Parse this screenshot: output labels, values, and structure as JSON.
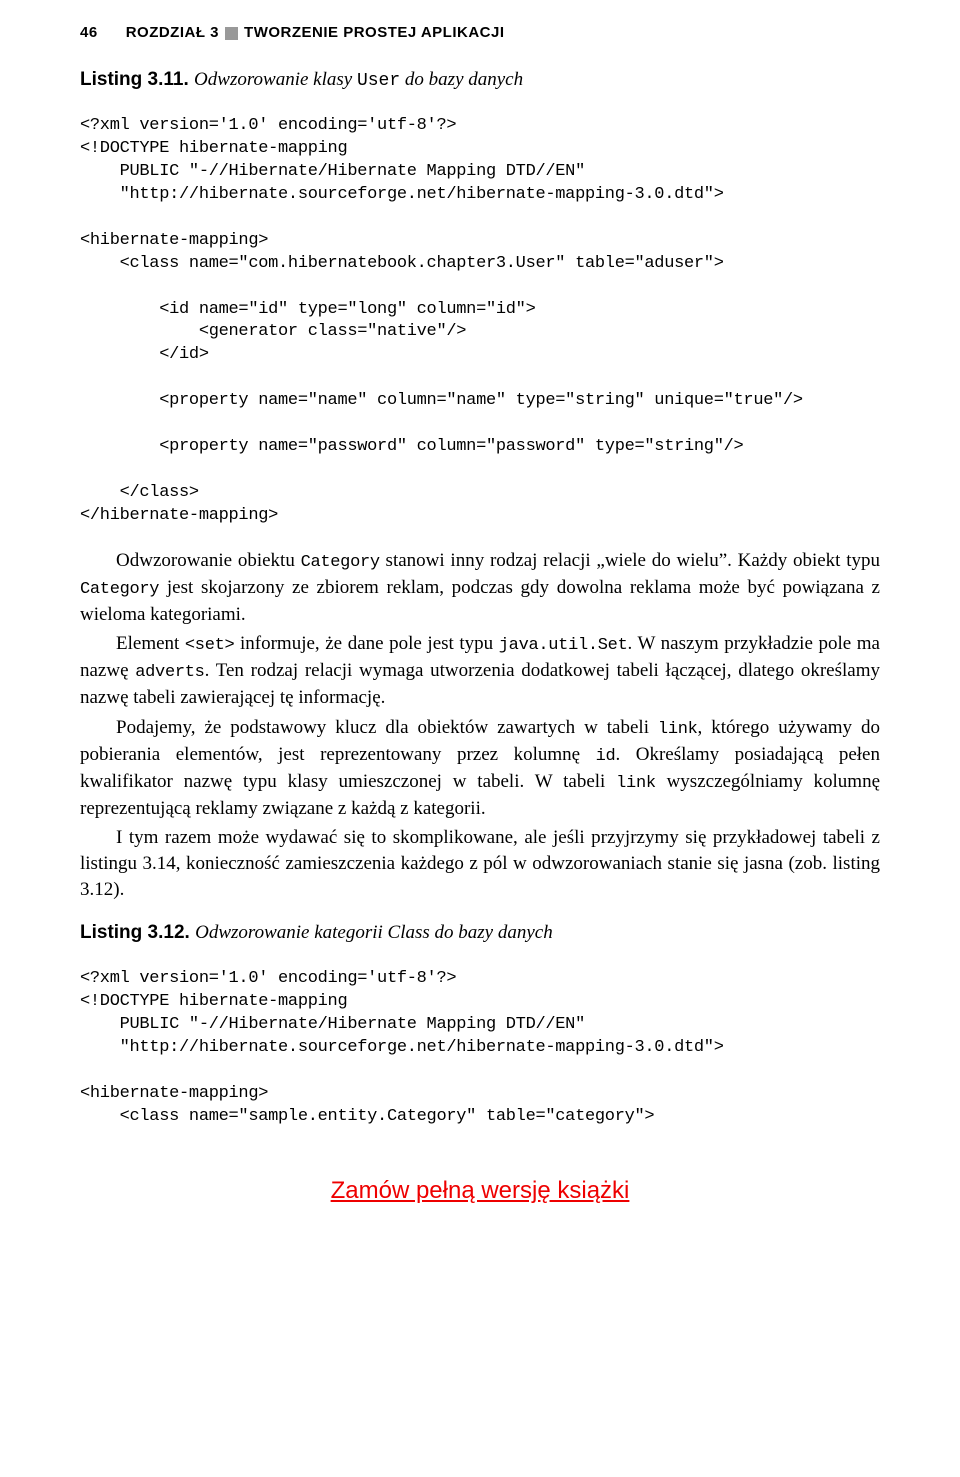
{
  "header": {
    "page_number": "46",
    "chapter_prefix": "ROZDZIAŁ 3",
    "chapter_title": "TWORZENIE PROSTEJ APLIKACJI"
  },
  "listing311": {
    "label": "Listing 3.11.",
    "caption_before": "Odwzorowanie klasy ",
    "caption_mono": "User",
    "caption_after": " do bazy danych",
    "code": "<?xml version='1.0' encoding='utf-8'?>\n<!DOCTYPE hibernate-mapping\n    PUBLIC \"-//Hibernate/Hibernate Mapping DTD//EN\"\n    \"http://hibernate.sourceforge.net/hibernate-mapping-3.0.dtd\">\n\n<hibernate-mapping>\n    <class name=\"com.hibernatebook.chapter3.User\" table=\"aduser\">\n\n        <id name=\"id\" type=\"long\" column=\"id\">\n            <generator class=\"native\"/>\n        </id>\n\n        <property name=\"name\" column=\"name\" type=\"string\" unique=\"true\"/>\n\n        <property name=\"password\" column=\"password\" type=\"string\"/>\n\n    </class>\n</hibernate-mapping>"
  },
  "paragraphs": {
    "p1a": "Odwzorowanie obiektu ",
    "p1_mono1": "Category",
    "p1b": " stanowi inny rodzaj relacji „wiele do wielu”. Każdy obiekt typu ",
    "p1_mono2": "Category",
    "p1c": " jest skojarzony ze zbiorem reklam, podczas gdy dowolna reklama może być powiązana z wieloma kategoriami.",
    "p2a": "Element ",
    "p2_mono1": "<set>",
    "p2b": " informuje, że dane pole jest typu ",
    "p2_mono2": "java.util.Set",
    "p2c": ". W naszym przykładzie pole ma nazwę ",
    "p2_mono3": "adverts",
    "p2d": ". Ten rodzaj relacji wymaga utworzenia dodatkowej tabeli łączącej, dlatego określamy nazwę tabeli zawierającej tę informację.",
    "p3a": "Podajemy, że podstawowy klucz dla obiektów zawartych w tabeli ",
    "p3_mono1": "link",
    "p3b": ", którego używamy do pobierania elementów, jest reprezentowany przez kolumnę ",
    "p3_mono2": "id",
    "p3c": ". Określamy posiadającą pełen kwalifikator nazwę typu klasy umieszczonej w tabeli. W tabeli ",
    "p3_mono3": "link",
    "p3d": " wyszczególniamy kolumnę reprezentującą reklamy związane z każdą z kategorii.",
    "p4": "I tym razem może wydawać się to skomplikowane, ale jeśli przyjrzymy się przykładowej tabeli z listingu 3.14, konieczność zamieszczenia każdego z pól w odwzorowaniach stanie się jasna (zob. listing 3.12)."
  },
  "listing312": {
    "label": "Listing 3.12.",
    "caption": "Odwzorowanie kategorii Class do bazy danych",
    "code": "<?xml version='1.0' encoding='utf-8'?>\n<!DOCTYPE hibernate-mapping\n    PUBLIC \"-//Hibernate/Hibernate Mapping DTD//EN\"\n    \"http://hibernate.sourceforge.net/hibernate-mapping-3.0.dtd\">\n\n<hibernate-mapping>\n    <class name=\"sample.entity.Category\" table=\"category\">"
  },
  "footer": {
    "link_text": "Zamów pełną wersję książki"
  }
}
